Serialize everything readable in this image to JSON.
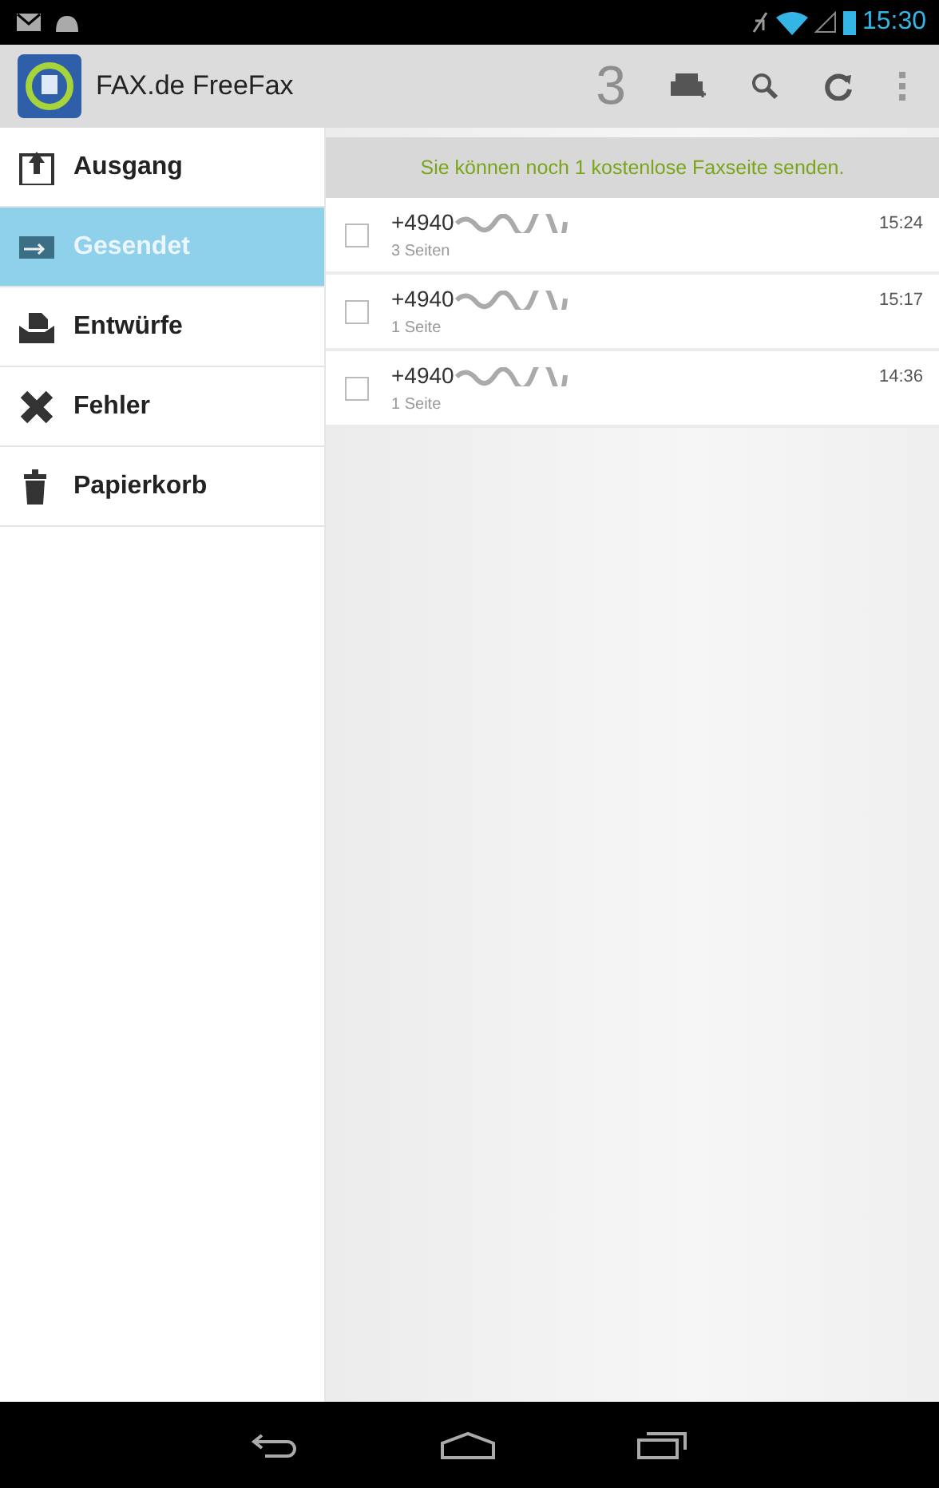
{
  "status_bar": {
    "time": "15:30"
  },
  "action_bar": {
    "title": "FAX.de FreeFax",
    "count": "3"
  },
  "sidebar": {
    "items": [
      {
        "label": "Ausgang",
        "selected": false
      },
      {
        "label": "Gesendet",
        "selected": true
      },
      {
        "label": "Entwürfe",
        "selected": false
      },
      {
        "label": "Fehler",
        "selected": false
      },
      {
        "label": "Papierkorb",
        "selected": false
      }
    ]
  },
  "banner": "Sie können noch 1 kostenlose Faxseite senden.",
  "faxes": [
    {
      "number": "+4940",
      "pages": "3 Seiten",
      "time": "15:24",
      "checked": false
    },
    {
      "number": "+4940",
      "pages": "1 Seite",
      "time": "15:17",
      "checked": false
    },
    {
      "number": "+4940",
      "pages": "1 Seite",
      "time": "14:36",
      "checked": false
    }
  ]
}
